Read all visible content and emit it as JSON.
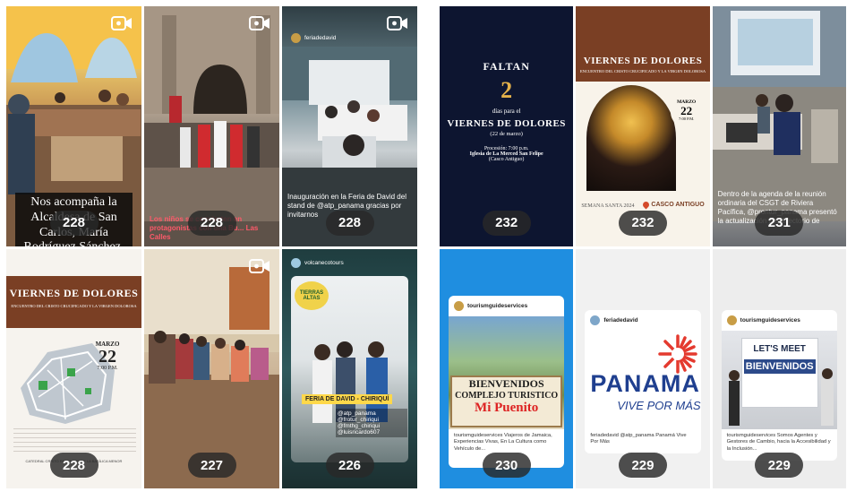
{
  "left_tiles": [
    {
      "count": "228",
      "overlay": "Nos acompaña la Alcaldesa de San Carlos, María Rodríguez Sánchez.",
      "video": true
    },
    {
      "count": "228",
      "overlay": "Los niños se convierten en protagonistas con una Bu... Las Calles",
      "video": true
    },
    {
      "count": "228",
      "handle": "feriadedavid",
      "overlay": "Inauguración en la Feria de David del stand de @atp_panama gracias por invitarnos",
      "video": true
    },
    {
      "count": "228",
      "title": "VIERNES DE DOLORES",
      "subtitle": "ENCUENTRO DEL CRISTO CRUCIFICADO Y LA VIRGEN DOLOROSA",
      "date_month": "MARZO",
      "date_day": "22",
      "date_time": "7:00 P.M.",
      "footer": "CATEDRAL CRISTO REDENTOR DE LA BASÍLICA MENOR"
    },
    {
      "count": "227",
      "video": true
    },
    {
      "count": "226",
      "handle": "volcanecotours",
      "badge": "FERIA DE DAVID - CHIRIQUÍ",
      "logo_text": "TIERRAS ALTAS",
      "tags": "@atp_panama @frotur_chiriqui @fmthg_chiriqui @luisricardo607"
    }
  ],
  "right_tiles": [
    {
      "count": "232",
      "line1": "FALTAN",
      "number": "2",
      "line2": "días para el",
      "title": "VIERNES DE DOLORES",
      "date": "(22 de marzo)",
      "detail1": "Procesión: 7:00 p.m.",
      "detail2": "Iglesia de La Merced San Felipe",
      "detail3": "(Casco Antiguo)"
    },
    {
      "count": "232",
      "title": "VIERNES DE DOLORES",
      "subtitle": "ENCUENTRO DEL CRISTO CRUCIFICADO Y LA VIRGEN DOLOROSA",
      "date_month": "MARZO",
      "date_day": "22",
      "date_time": "7:00 P.M.",
      "footer_left": "SEMANA SANTA 2024",
      "footer_right": "CASCO ANTIGUO"
    },
    {
      "count": "231",
      "overlay": "Dentro de la agenda de la reunión ordinaria del CSGT de Riviera Pacífica, @prontur_panama presentó la actualización del directorio de"
    },
    {
      "count": "230",
      "handle": "tourismguideservices",
      "sign1": "BIENVENIDOS",
      "sign2": "COMPLEJO TURISTICO",
      "sign3": "Mi Puenito",
      "caption": "tourismguideservices Viajeros de Jamaica, Experiencias Vivas, En La Cultura como Vehículo de..."
    },
    {
      "count": "229",
      "handle": "feriadedavid",
      "brand": "PANAMA",
      "tagline": "VIVE POR MÁS",
      "caption": "feriadedavid @atp_panama Panamá Vive Por Más"
    },
    {
      "count": "229",
      "handle": "tourismguideservices",
      "sign1": "LET'S MEET",
      "sign2": "BIENVENIDOS",
      "caption": "tourismguideservices Somos Agentes y Gestores de Cambio, hacia la Accesibilidad y la Inclusión..."
    }
  ],
  "colors": {
    "pill_bg": "#2a2a2a",
    "vd_banner": "#7a3f24",
    "gold": "#e2b04a",
    "navy": "#0d1530",
    "panama_blue": "#1f3f8f",
    "panama_red": "#e43a2f"
  }
}
